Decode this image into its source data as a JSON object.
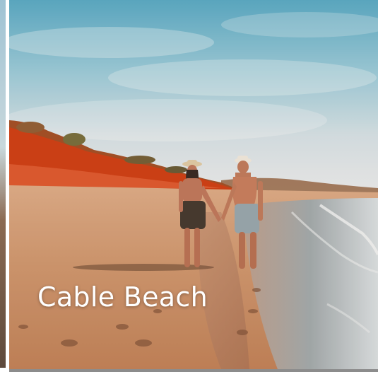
{
  "card": {
    "title": "Cable Beach"
  },
  "colors": {
    "sky_top": "#4fa6c4",
    "sky_bottom": "#e4e9ec",
    "cliff_red": "#c73a12",
    "sand": "#c8946e",
    "caption_text": "#ffffff"
  }
}
